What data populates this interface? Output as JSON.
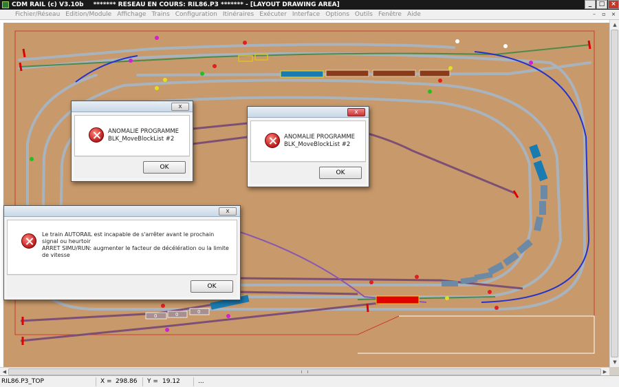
{
  "window": {
    "app_title": "CDM RAIL (c) V3.10b",
    "doc_title": "******* RESEAU EN COURS: RIL86.P3 ******* - [LAYOUT DRAWING AREA]",
    "minimize": "_",
    "maximize": "□",
    "close": "×"
  },
  "menu": {
    "items": [
      "Fichier/Réseau",
      "Edition/Module",
      "Affichage",
      "Trains",
      "Configuration",
      "Itinéraires",
      "Exécuter",
      "Interface",
      "Options",
      "Outils",
      "Fenêtre",
      "Aide"
    ],
    "mdi_minimize": "–",
    "mdi_restore": "▫",
    "mdi_close": "×"
  },
  "colors": {
    "board": "#c8996a",
    "track_gray": "#a9b3be",
    "track_purple": "#7d4f74",
    "track_blue": "#2533c8",
    "track_green": "#4b8a4b",
    "train_blue": "#1a7bb0",
    "wagon_brown": "#8b3a1a",
    "train_red": "#e00000",
    "train_slate": "#6c8aa6",
    "border_red": "#d02020"
  },
  "dialogs": [
    {
      "message": "ANOMALIE PROGRAMME\nBLK_MoveBlockList #2",
      "ok_label": "OK",
      "close_label": "x"
    },
    {
      "message": "ANOMALIE PROGRAMME\nBLK_MoveBlockList #2",
      "ok_label": "OK",
      "close_label": "x"
    },
    {
      "message": "Le train AUTORAIL est incapable de s'arrêter avant le prochain signal ou heurtoir\nARRET SIMU/RUN: augmenter le facteur de décélération ou la limite de vitesse",
      "ok_label": "OK",
      "close_label": "x"
    }
  ],
  "wagon_labels": [
    "0",
    "0",
    "0"
  ],
  "status": {
    "file": "RIL86.P3_TOP",
    "x_label": "X =",
    "x_value": "298.86",
    "y_label": "Y =",
    "y_value": "19.12",
    "extra": "..."
  }
}
